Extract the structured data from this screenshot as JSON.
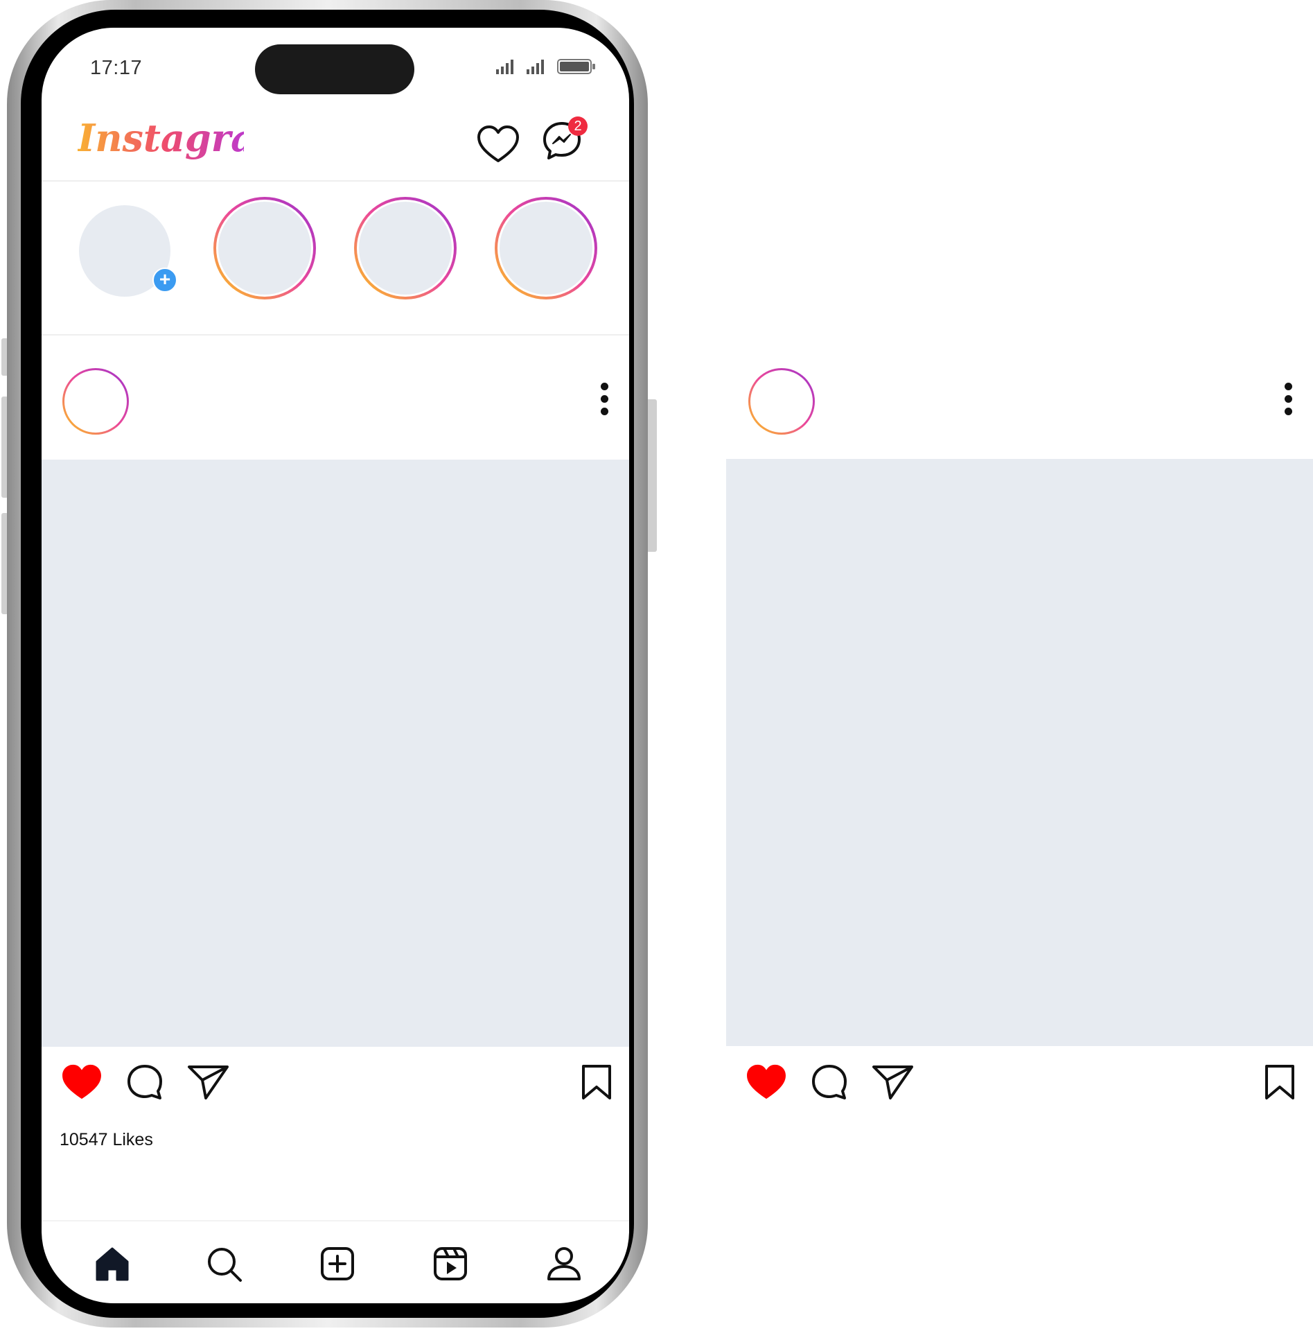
{
  "status_bar": {
    "time": "17:17"
  },
  "header": {
    "logo_text": "Instagram",
    "messages_badge": "2"
  },
  "stories": {
    "add_symbol": "+"
  },
  "post": {
    "likes": "10547 Likes"
  },
  "colors": {
    "accent_blue": "#3b9bf1",
    "badge_red": "#ef2b40",
    "like_red": "#ff0000",
    "placeholder": "#e7ebf1"
  },
  "icons": [
    "heart-icon",
    "messenger-icon",
    "more-icon",
    "like-filled-icon",
    "comment-icon",
    "share-icon",
    "bookmark-icon",
    "home-icon",
    "search-icon",
    "add-icon",
    "reels-icon",
    "profile-icon"
  ]
}
